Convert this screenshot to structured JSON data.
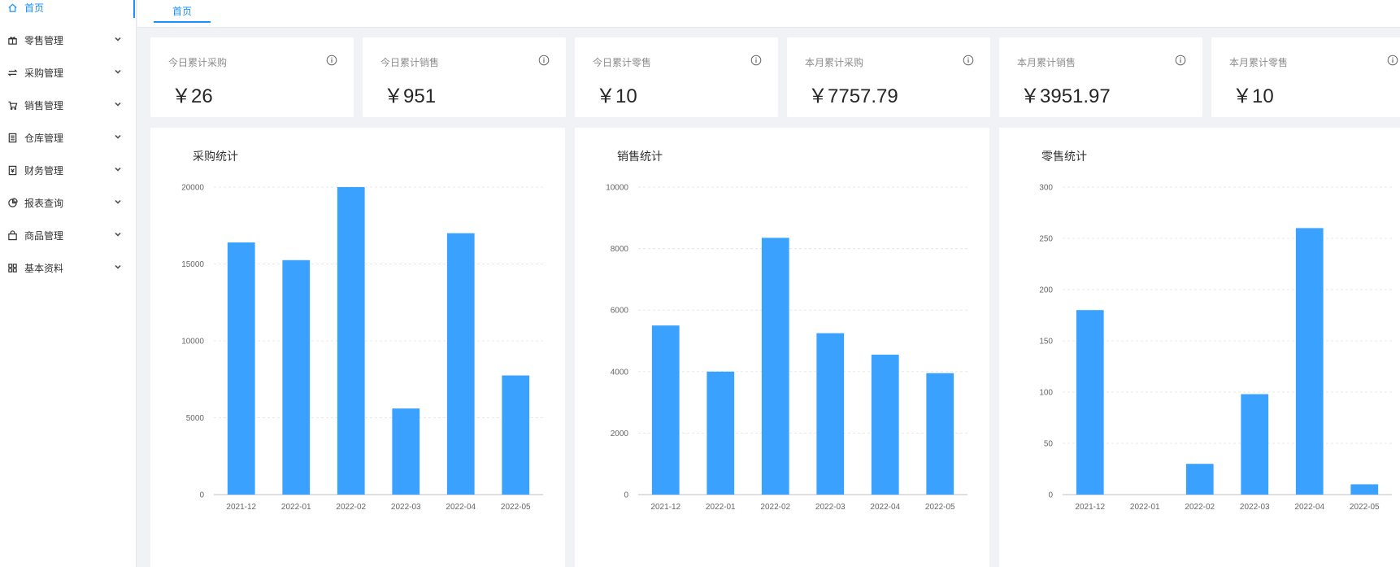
{
  "sidebar": {
    "items": [
      {
        "label": "首页",
        "icon": "home-icon",
        "active": true,
        "arrow": false
      },
      {
        "label": "零售管理",
        "icon": "gift-icon",
        "active": false,
        "arrow": true
      },
      {
        "label": "采购管理",
        "icon": "swap-icon",
        "active": false,
        "arrow": true
      },
      {
        "label": "销售管理",
        "icon": "cart-icon",
        "active": false,
        "arrow": true
      },
      {
        "label": "仓库管理",
        "icon": "warehouse-icon",
        "active": false,
        "arrow": true
      },
      {
        "label": "财务管理",
        "icon": "account-book-icon",
        "active": false,
        "arrow": true
      },
      {
        "label": "报表查询",
        "icon": "pie-chart-icon",
        "active": false,
        "arrow": true
      },
      {
        "label": "商品管理",
        "icon": "shopping-bag-icon",
        "active": false,
        "arrow": true
      },
      {
        "label": "基本资料",
        "icon": "appstore-icon",
        "active": false,
        "arrow": true
      }
    ]
  },
  "tabs": [
    {
      "label": "首页"
    }
  ],
  "stats": [
    {
      "title": "今日累计采购",
      "value": "￥26"
    },
    {
      "title": "今日累计销售",
      "value": "￥951"
    },
    {
      "title": "今日累计零售",
      "value": "￥10"
    },
    {
      "title": "本月累计采购",
      "value": "￥7757.79"
    },
    {
      "title": "本月累计销售",
      "value": "￥3951.97"
    },
    {
      "title": "本月累计零售",
      "value": "￥10"
    }
  ],
  "colors": {
    "accent": "#1890ff",
    "bar": "#3ba1ff"
  },
  "chart_data": [
    {
      "type": "bar",
      "title": "采购统计",
      "categories": [
        "2021-12",
        "2022-01",
        "2022-02",
        "2022-03",
        "2022-04",
        "2022-05"
      ],
      "values": [
        16400,
        15250,
        20000,
        5600,
        17000,
        7750
      ],
      "ylim": [
        0,
        20000
      ],
      "yticks": [
        0,
        5000,
        10000,
        15000,
        20000
      ],
      "grid": true
    },
    {
      "type": "bar",
      "title": "销售统计",
      "categories": [
        "2021-12",
        "2022-01",
        "2022-02",
        "2022-03",
        "2022-04",
        "2022-05"
      ],
      "values": [
        5500,
        4000,
        8350,
        5250,
        4550,
        3950
      ],
      "ylim": [
        0,
        10000
      ],
      "yticks": [
        0,
        2000,
        4000,
        6000,
        8000,
        10000
      ],
      "grid": true
    },
    {
      "type": "bar",
      "title": "零售统计",
      "categories": [
        "2021-12",
        "2022-01",
        "2022-02",
        "2022-03",
        "2022-04",
        "2022-05"
      ],
      "values": [
        180,
        0,
        30,
        98,
        260,
        10
      ],
      "ylim": [
        0,
        300
      ],
      "yticks": [
        0,
        50,
        100,
        150,
        200,
        250,
        300
      ],
      "grid": true
    }
  ]
}
